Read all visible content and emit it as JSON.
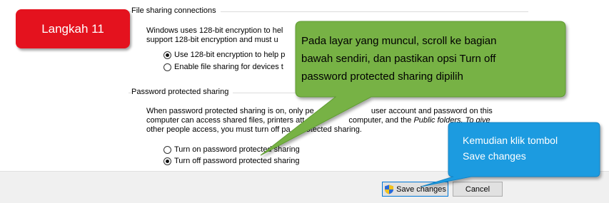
{
  "dialog": {
    "file_sharing": {
      "title": "File sharing connections",
      "para_line1": "Windows uses 128-bit encryption to hel",
      "para_line2": "support 128-bit encryption and must u",
      "option1": "Use 128-bit encryption to help p",
      "option2": "Enable file sharing for devices t"
    },
    "password_sharing": {
      "title": "Password protected sharing",
      "para_line1_a": "When password protected sharing is on, only pe",
      "para_line1_b": "user account and password on this",
      "para_line2_a": "computer can access shared files, printers att",
      "para_line2_b": "computer, and the",
      "para_line2_c": "Public folders",
      "para_line2_d": ". To give",
      "para_line3_a": "other people access, you must turn off pa",
      "para_line3_b": "otected sharing.",
      "option_on": "Turn on password protected sharing",
      "option_off": "Turn off password protected sharing",
      "selected": "off"
    },
    "buttons": {
      "save": "Save changes",
      "cancel": "Cancel"
    }
  },
  "annotations": {
    "step_label": "Langkah 11",
    "callout_main": [
      "Pada layar yang muncul, scroll ke bagian",
      "bawah sendiri, dan pastikan opsi Turn off",
      "password protected sharing  dipilih"
    ],
    "callout_button": [
      "Kemudian klik tombol",
      "Save changes"
    ]
  },
  "colors": {
    "step_badge": "#e4121e",
    "callout_main": "#77b244",
    "callout_button": "#1c9be0"
  }
}
